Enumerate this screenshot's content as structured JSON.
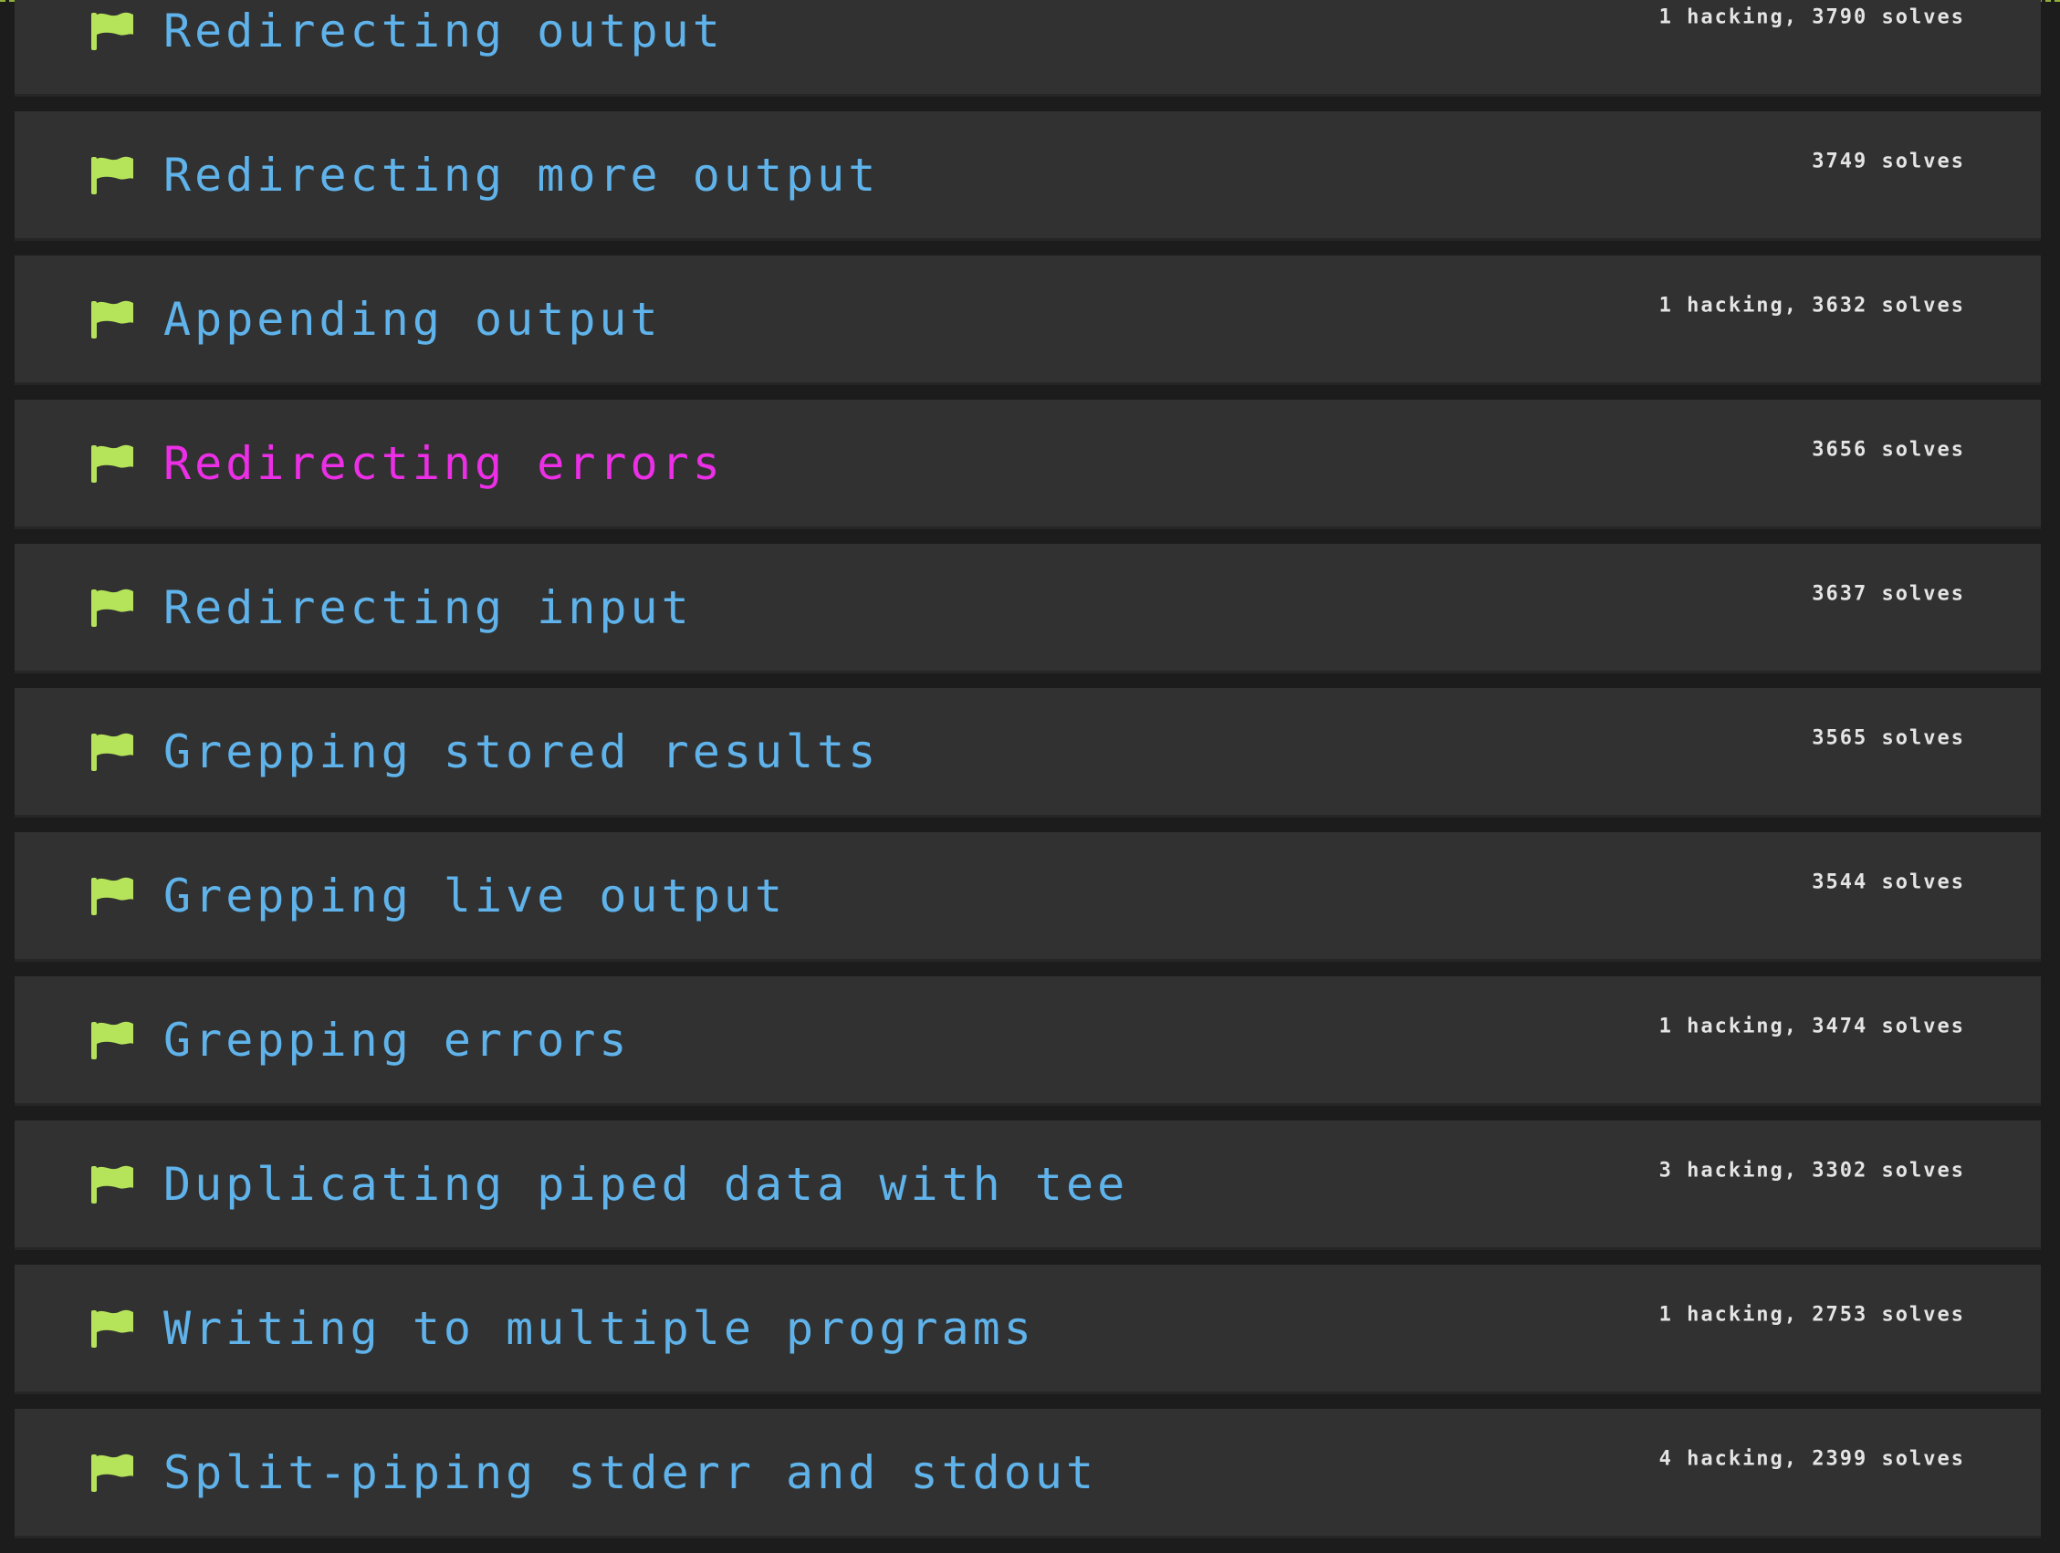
{
  "colors": {
    "flag": "#b5e35a",
    "title_default": "#5fb3ea",
    "title_active": "#ec2fe6",
    "stats": "#e4e4e4",
    "row_background": "#313131",
    "page_background": "#1c1c1c"
  },
  "challenges": [
    {
      "icon": "flag-icon",
      "title": "Redirecting output",
      "stats": "1 hacking, 3790 solves",
      "active": false
    },
    {
      "icon": "flag-icon",
      "title": "Redirecting more output",
      "stats": "3749 solves",
      "active": false
    },
    {
      "icon": "flag-icon",
      "title": "Appending output",
      "stats": "1 hacking, 3632 solves",
      "active": false
    },
    {
      "icon": "flag-icon",
      "title": "Redirecting errors",
      "stats": "3656 solves",
      "active": true
    },
    {
      "icon": "flag-icon",
      "title": "Redirecting input",
      "stats": "3637 solves",
      "active": false
    },
    {
      "icon": "flag-icon",
      "title": "Grepping stored results",
      "stats": "3565 solves",
      "active": false
    },
    {
      "icon": "flag-icon",
      "title": "Grepping live output",
      "stats": "3544 solves",
      "active": false
    },
    {
      "icon": "flag-icon",
      "title": "Grepping errors",
      "stats": "1 hacking, 3474 solves",
      "active": false
    },
    {
      "icon": "flag-icon",
      "title": "Duplicating piped data with tee",
      "stats": "3 hacking, 3302 solves",
      "active": false
    },
    {
      "icon": "flag-icon",
      "title": "Writing to multiple programs",
      "stats": "1 hacking, 2753 solves",
      "active": false
    },
    {
      "icon": "flag-icon",
      "title": "Split-piping stderr and stdout",
      "stats": "4 hacking, 2399 solves",
      "active": false
    }
  ]
}
